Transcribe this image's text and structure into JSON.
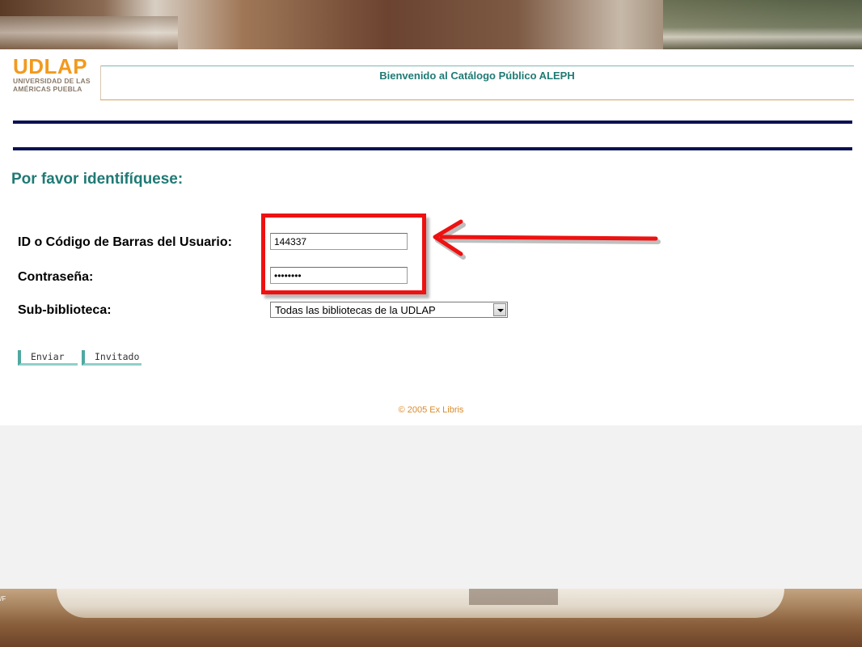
{
  "header": {
    "logo_main": "UDLAP",
    "logo_line1": "UNIVERSIDAD DE LAS",
    "logo_line2": "AMÉRICAS PUEBLA",
    "welcome": "Bienvenido al Catálogo Público ALEPH"
  },
  "form": {
    "heading": "Por favor identifíquese:",
    "id_label": "ID o Código de Barras del Usuario:",
    "id_value": "144337",
    "password_label": "Contraseña:",
    "password_value": "********",
    "sublibrary_label": "Sub-biblioteca:",
    "sublibrary_selected": "Todas las bibliotecas de la UDLAP",
    "submit_label": "Enviar",
    "guest_label": "Invitado"
  },
  "footer": {
    "copyright": "© 2005 Ex Libris"
  },
  "annotation": {
    "color": "#ee1111"
  },
  "colors": {
    "brand_orange": "#f29a1e",
    "teal": "#1f7a74",
    "navy": "#0b1152"
  },
  "corner_mark": "/F"
}
